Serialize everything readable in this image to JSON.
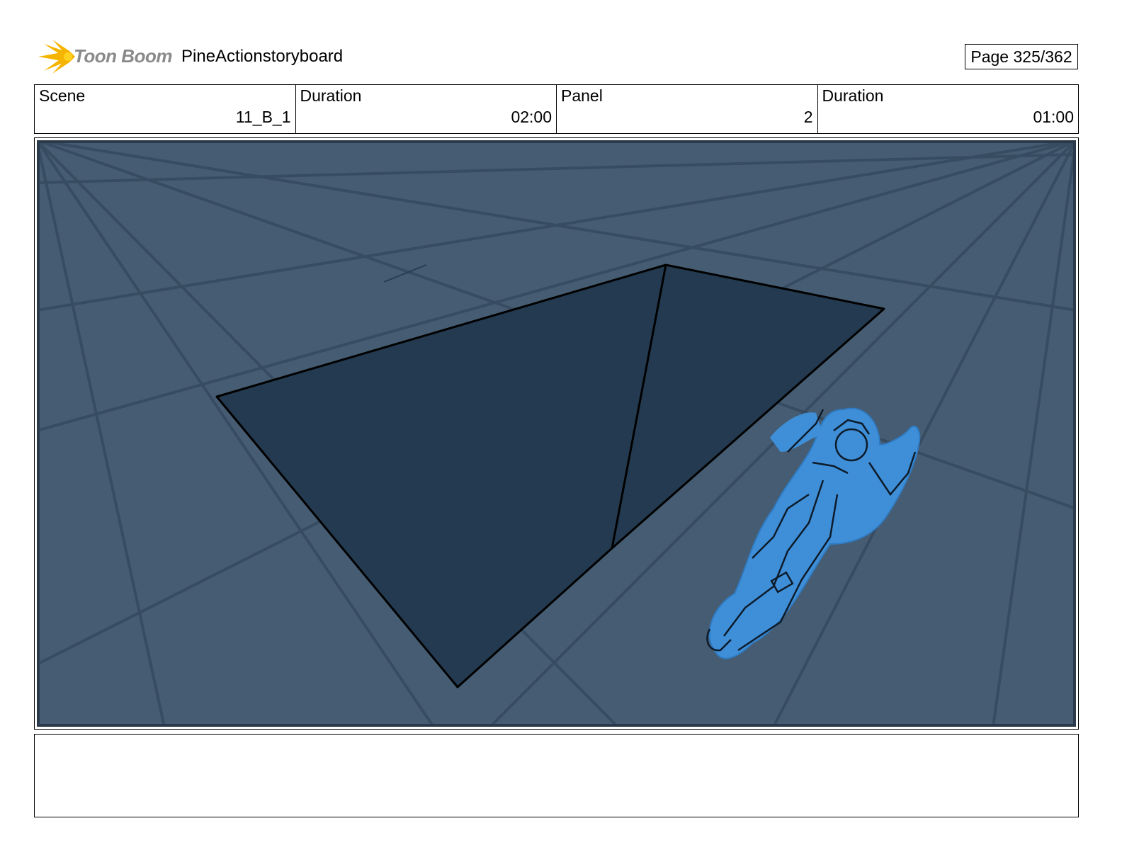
{
  "header": {
    "logo_text": "Toon Boom",
    "project_title": "PineActionstoryboard",
    "page_label": "Page 325/362"
  },
  "info": {
    "scene_label": "Scene",
    "scene_value": "11_B_1",
    "scene_duration_label": "Duration",
    "scene_duration_value": "02:00",
    "panel_label": "Panel",
    "panel_value": "2",
    "panel_duration_label": "Duration",
    "panel_duration_value": "01:00"
  },
  "panel": {
    "background_color": "#455c72",
    "shape_color": "#233a50",
    "character_color": "#3f8fd8"
  },
  "notes": {
    "text": ""
  }
}
